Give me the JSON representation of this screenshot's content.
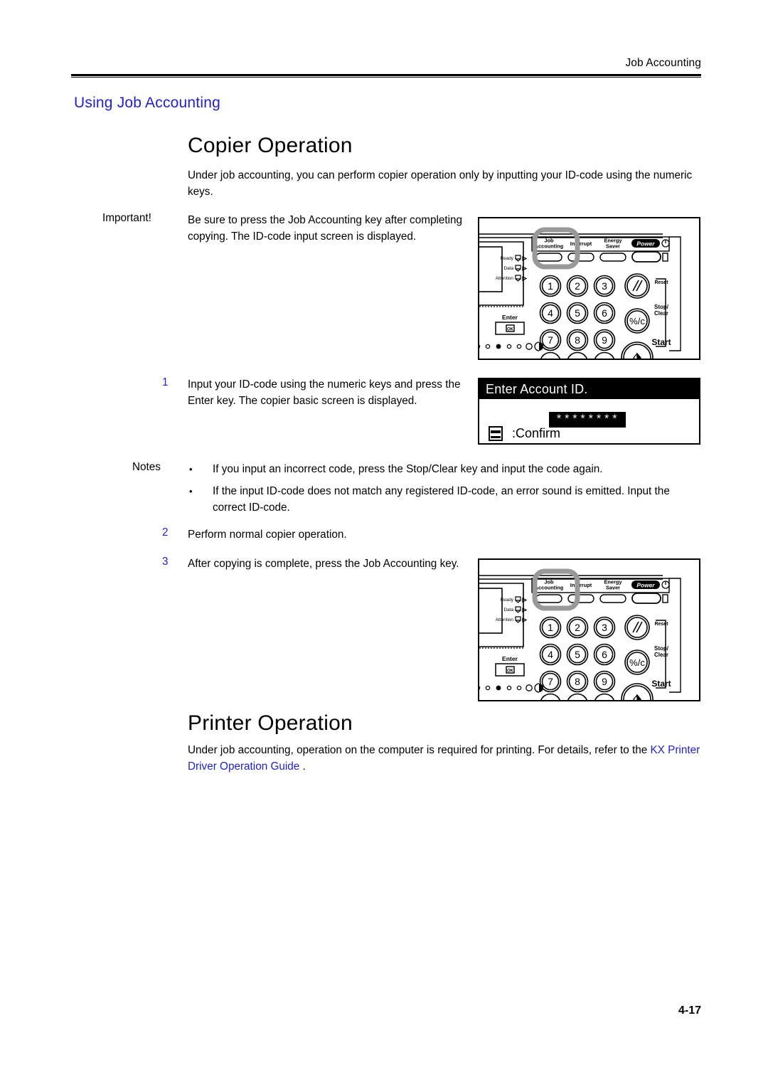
{
  "page": {
    "running_header": "Job Accounting",
    "page_number": "4-17"
  },
  "section": {
    "heading": "Using Job Accounting"
  },
  "copier": {
    "title": "Copier Operation",
    "intro": "Under job accounting, you can perform copier operation only by inputting your ID-code using the numeric keys.",
    "important_label": "Important!",
    "important_text": "Be sure to press the Job Accounting key after completing copying. The ID-code input screen is displayed.",
    "notes_label": "Notes",
    "bullet": "•",
    "notes": [
      "If you input an incorrect code, press the Stop/Clear key and input the code again.",
      "If the input ID-code does not match any registered ID-code, an error sound is emitted. Input the correct ID-code."
    ],
    "steps": [
      {
        "num": "1",
        "text": "Input your ID-code using the numeric keys and press the Enter key. The copier basic screen is displayed."
      },
      {
        "num": "2",
        "text": "Perform normal copier operation."
      },
      {
        "num": "3",
        "text": "After copying is complete, press the Job Accounting key."
      }
    ]
  },
  "printer": {
    "title": "Printer Operation",
    "intro_before": "Under job accounting, operation on the computer is required for printing. For details, refer to the ",
    "intro_link": "KX Printer Driver Operation Guide",
    "intro_after": " ."
  },
  "lcd": {
    "title": "Enter Account ID.",
    "masked_value": "********",
    "confirm_label": ":Confirm",
    "icon": "enter-key-icon"
  },
  "control_panel": {
    "function_keys": [
      {
        "label_line1": "Job",
        "label_line2": "Accounting"
      },
      {
        "label_line1": "Interrupt",
        "label_line2": ""
      },
      {
        "label_line1": "Energy",
        "label_line2": "Saver"
      },
      {
        "label_line1": "Power",
        "label_line2": ""
      }
    ],
    "indicators": [
      "Ready",
      "Data",
      "Attention"
    ],
    "enter_label": "Enter",
    "enter_key_glyph": "OK",
    "numeric_keys": [
      "1",
      "2",
      "3",
      "4",
      "5",
      "6",
      "7",
      "8",
      "9"
    ],
    "right_keys": [
      "Reset",
      "Stop/Clear",
      "Start"
    ],
    "clear_key_glyph": "%/c",
    "highlight_target": "Job Accounting",
    "highlight_color": "#999999"
  },
  "colors": {
    "link_blue": "#2222cc",
    "text_black": "#000000",
    "page_bg": "#ffffff"
  }
}
